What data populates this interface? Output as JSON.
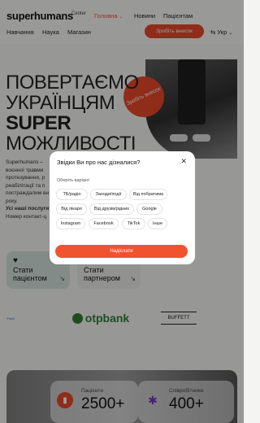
{
  "header": {
    "logo": "superhumans",
    "logo_sub": "Center",
    "nav_top": [
      "Головна",
      "Новини",
      "Пацієнтам"
    ],
    "nav_bottom": [
      "Навчання",
      "Наука",
      "Магазин"
    ],
    "cta": "Зробіть внесок",
    "lang": "Укр"
  },
  "hero": {
    "lines": [
      "ПОВЕРТАЄМО",
      "УКРАЇНЦЯМ",
      "SUPER",
      "МОЖЛИВОСТІ"
    ],
    "badge": "Зробіть внесок",
    "intro": [
      "Superhumans –",
      "воєнної травми",
      "протезування, р",
      "реабілітації та п",
      "постраждалим вн",
      "року."
    ],
    "intro_bold": [
      "Усі наші послуги",
      "Номер контакт-ц"
    ]
  },
  "cards": [
    {
      "label": "Стати пацієнтом"
    },
    {
      "label": "Стати партнером"
    }
  ],
  "partners": {
    "otp": "otpbank",
    "buffett": "BUFFETT",
    "small": "Fund"
  },
  "stats": [
    {
      "label": "Пацієнти",
      "value": "2500+"
    },
    {
      "label": "Співробітники",
      "value": "400+"
    }
  ],
  "modal": {
    "title": "Звідки Ви про нас дізналися?",
    "subtitle": "Оберіть варіант",
    "options": [
      "ТБ/радіо",
      "Заходи/події",
      "Від побратима",
      "Від лікаря",
      "Від друзів/рідних",
      "Google",
      "Instagram",
      "Facebook",
      "TikTok",
      "Інше"
    ],
    "submit": "Надіслати"
  }
}
